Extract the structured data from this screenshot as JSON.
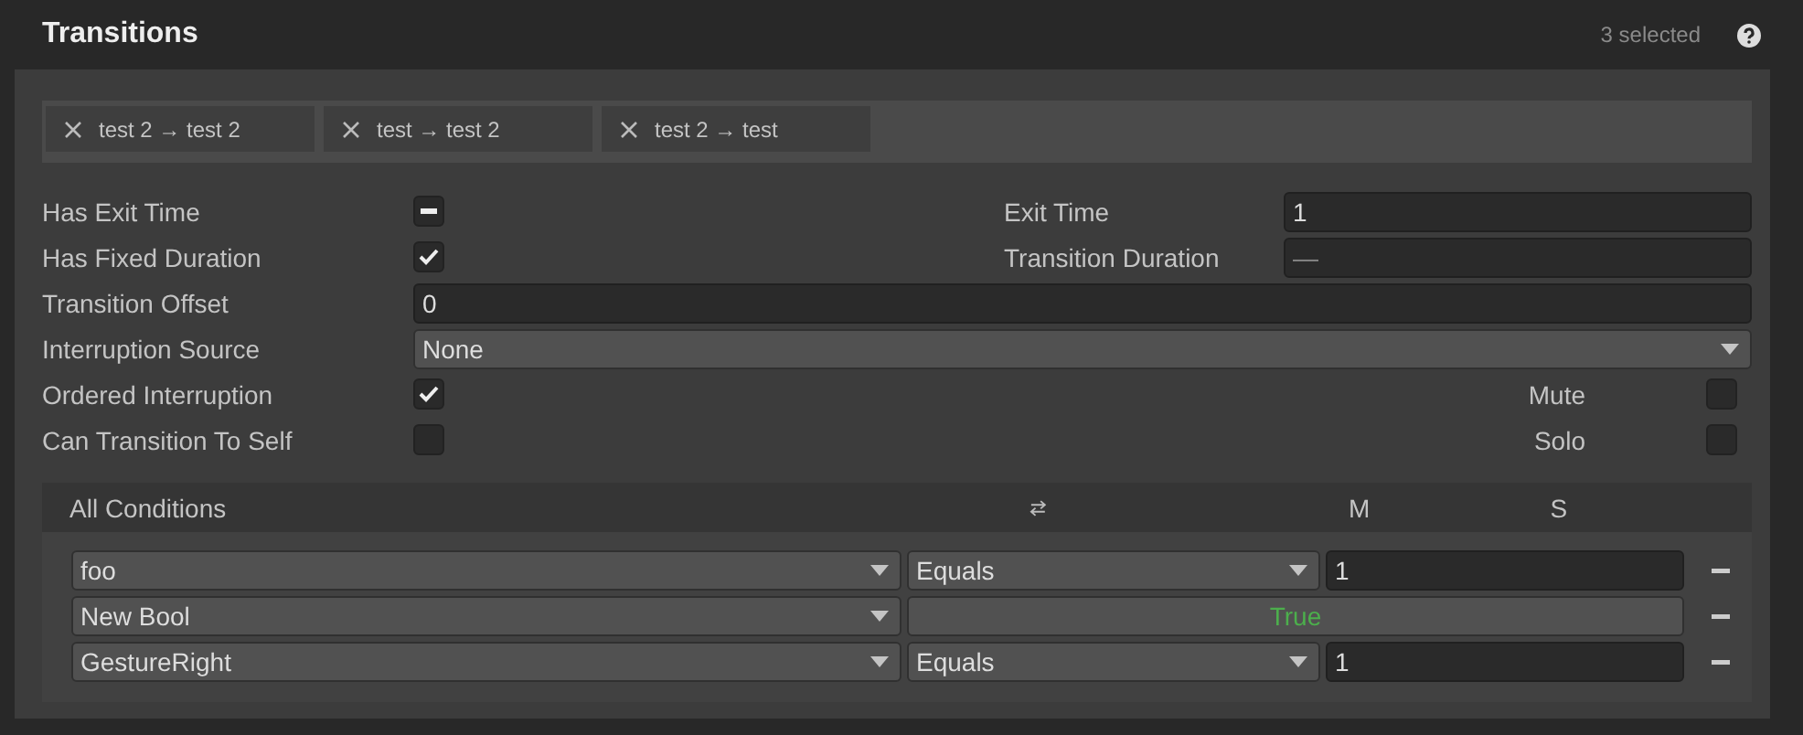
{
  "header": {
    "title": "Transitions",
    "selection_count": "3 selected"
  },
  "transitions": [
    {
      "label": "test  2 → test 2"
    },
    {
      "label": "test  → test  2"
    },
    {
      "label": "test  2 → test"
    }
  ],
  "properties": [
    {
      "left": {
        "label": "Has Exit Time",
        "kind": "checkbox",
        "checked": false,
        "mixed": true
      },
      "right": {
        "label": "Exit Time",
        "kind": "field",
        "value": "1"
      }
    },
    {
      "left": {
        "label": "Has Fixed Duration",
        "kind": "checkbox",
        "checked": true,
        "mixed": false
      },
      "right": {
        "label": "Transition Duration",
        "kind": "field",
        "value": "—"
      }
    },
    {
      "left": {
        "label": "Transition Offset",
        "kind": "field",
        "value": "0"
      }
    },
    {
      "left": {
        "label": "Interruption Source",
        "kind": "dropdown",
        "value": "None"
      }
    },
    {
      "left": {
        "label": "Ordered Interruption",
        "kind": "checkbox",
        "checked": true,
        "mixed": false
      },
      "right": {
        "label": "Mute",
        "kind": "checkbox",
        "checked": false,
        "mixed": false
      }
    },
    {
      "left": {
        "label": "Can Transition To Self",
        "kind": "checkbox",
        "checked": false,
        "mixed": false
      },
      "right": {
        "label": "Solo",
        "kind": "checkbox",
        "checked": false,
        "mixed": false
      }
    }
  ],
  "conditions": {
    "title": "All Conditions",
    "columns": [
      "M",
      "S"
    ],
    "rows": [
      {
        "parameter": "foo",
        "kind": "compare",
        "mode": "Equals",
        "value": "1"
      },
      {
        "parameter": "New Bool",
        "kind": "bool",
        "value": "True"
      },
      {
        "parameter": "GestureRight",
        "kind": "compare",
        "mode": "Equals",
        "value": "1"
      }
    ]
  }
}
